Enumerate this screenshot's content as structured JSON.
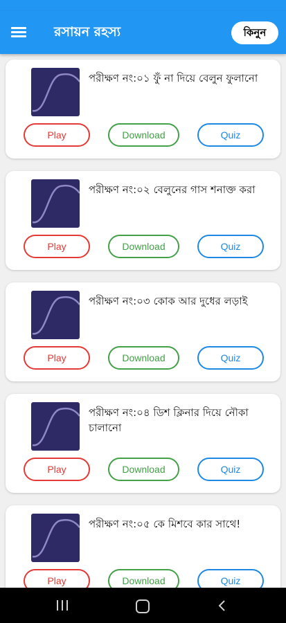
{
  "app_bar": {
    "title": "রসায়ন রহস্য",
    "buy_label": "কিনুন",
    "color": "#2196f3"
  },
  "experiments": [
    {
      "title": "পরীক্ষণ নং:০১ ফুঁ না দিয়ে বেলুন ফুলানো",
      "play_label": "Play",
      "download_label": "Download",
      "quiz_label": "Quiz"
    },
    {
      "title": "পরীক্ষণ নং:০২ বেলুনের গাস শনাক্ত করা",
      "play_label": "Play",
      "download_label": "Download",
      "quiz_label": "Quiz"
    },
    {
      "title": "পরীক্ষণ নং:০৩ কোক আর দুধের লড়াই",
      "play_label": "Play",
      "download_label": "Download",
      "quiz_label": "Quiz"
    },
    {
      "title": "পরীক্ষণ নং:০৪ ডিশ ক্লিনার দিয়ে নৌকা চালানো",
      "play_label": "Play",
      "download_label": "Download",
      "quiz_label": "Quiz"
    },
    {
      "title": "পরীক্ষণ নং:০৫ কে মিশবে কার সাথে!",
      "play_label": "Play",
      "download_label": "Download",
      "quiz_label": "Quiz"
    }
  ],
  "colors": {
    "play": "#e53935",
    "download": "#43a047",
    "quiz": "#1e88e5",
    "thumbnail": "#2e2a66"
  },
  "nav": {
    "recents_icon": "recents-icon",
    "home_icon": "home-icon",
    "back_icon": "back-icon"
  }
}
